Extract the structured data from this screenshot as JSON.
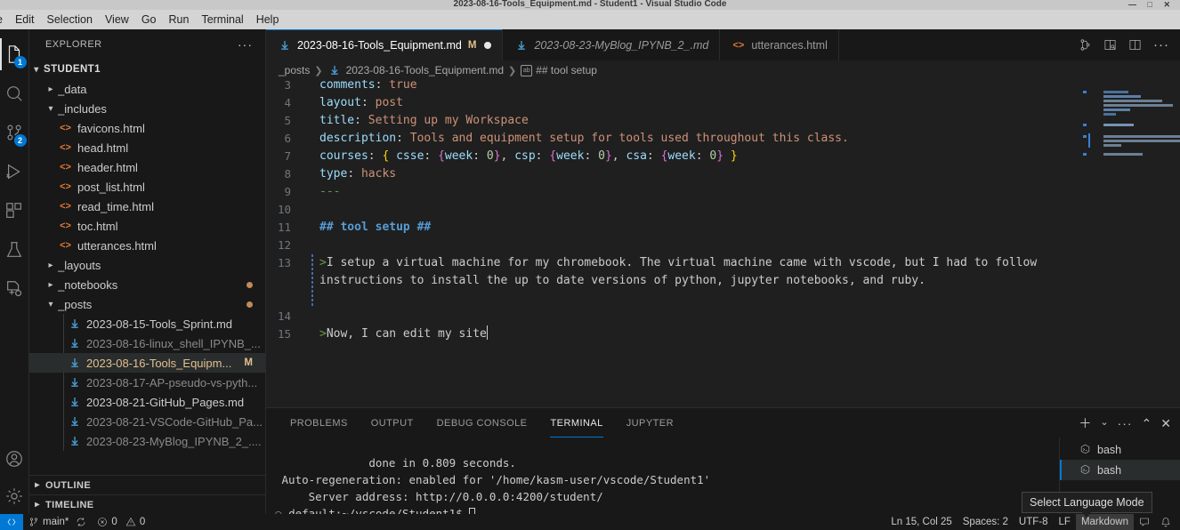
{
  "window": {
    "title": "2023-08-16-Tools_Equipment.md - Student1 - Visual Studio Code",
    "controls": "— □ ✕"
  },
  "menubar": {
    "items": [
      {
        "label": "e"
      },
      {
        "label": "Edit"
      },
      {
        "label": "Selection"
      },
      {
        "label": "View"
      },
      {
        "label": "Go"
      },
      {
        "label": "Run"
      },
      {
        "label": "Terminal"
      },
      {
        "label": "Help"
      }
    ]
  },
  "activitybar": {
    "items": [
      {
        "name": "explorer",
        "icon": "files-icon",
        "badge": "1",
        "selected": true
      },
      {
        "name": "search",
        "icon": "search-icon",
        "badge": "",
        "selected": false
      },
      {
        "name": "source-control",
        "icon": "source-control-icon",
        "badge": "2",
        "selected": false
      },
      {
        "name": "run-debug",
        "icon": "run-debug-icon",
        "badge": "",
        "selected": false
      },
      {
        "name": "extensions",
        "icon": "extensions-icon",
        "badge": "",
        "selected": false
      },
      {
        "name": "testing",
        "icon": "beaker-icon",
        "badge": "",
        "selected": false
      },
      {
        "name": "remote-explorer",
        "icon": "remote-explorer-icon",
        "badge": "",
        "selected": false
      }
    ],
    "bottom": [
      {
        "name": "accounts",
        "icon": "account-icon"
      },
      {
        "name": "manage",
        "icon": "gear-icon"
      }
    ]
  },
  "sidebar": {
    "title": "EXPLORER",
    "more_label": "···",
    "root": {
      "label": "STUDENT1",
      "expanded": true
    },
    "tree": [
      {
        "label": "_data",
        "type": "folder",
        "expanded": false,
        "depth": 1,
        "dirty": false
      },
      {
        "label": "_includes",
        "type": "folder",
        "expanded": true,
        "depth": 1,
        "dirty": false
      },
      {
        "label": "favicons.html",
        "type": "html",
        "depth": 2
      },
      {
        "label": "head.html",
        "type": "html",
        "depth": 2
      },
      {
        "label": "header.html",
        "type": "html",
        "depth": 2
      },
      {
        "label": "post_list.html",
        "type": "html",
        "depth": 2
      },
      {
        "label": "read_time.html",
        "type": "html",
        "depth": 2
      },
      {
        "label": "toc.html",
        "type": "html",
        "depth": 2
      },
      {
        "label": "utterances.html",
        "type": "html",
        "depth": 2
      },
      {
        "label": "_layouts",
        "type": "folder",
        "expanded": false,
        "depth": 1,
        "dirty": false
      },
      {
        "label": "_notebooks",
        "type": "folder",
        "expanded": false,
        "depth": 1,
        "dirty": true
      },
      {
        "label": "_posts",
        "type": "folder",
        "expanded": true,
        "depth": 1,
        "dirty": true
      },
      {
        "label": "2023-08-15-Tools_Sprint.md",
        "type": "md",
        "depth": 2,
        "bright": true
      },
      {
        "label": "2023-08-16-linux_shell_IPYNB_...",
        "type": "md",
        "depth": 2,
        "bright": false
      },
      {
        "label": "2023-08-16-Tools_Equipm...",
        "type": "md",
        "depth": 2,
        "selected": true,
        "flag": "M"
      },
      {
        "label": "2023-08-17-AP-pseudo-vs-pyth...",
        "type": "md",
        "depth": 2,
        "bright": false
      },
      {
        "label": "2023-08-21-GitHub_Pages.md",
        "type": "md",
        "depth": 2,
        "bright": true
      },
      {
        "label": "2023-08-21-VSCode-GitHub_Pa...",
        "type": "md",
        "depth": 2,
        "bright": false
      },
      {
        "label": "2023-08-23-MyBlog_IPYNB_2_....",
        "type": "md",
        "depth": 2,
        "bright": false
      }
    ],
    "sections": [
      {
        "label": "OUTLINE",
        "expanded": false
      },
      {
        "label": "TIMELINE",
        "expanded": false
      }
    ]
  },
  "tabs": [
    {
      "label": "2023-08-16-Tools_Equipment.md",
      "type": "md",
      "active": true,
      "italic": false,
      "modified_flag": "M",
      "dirty": true
    },
    {
      "label": "2023-08-23-MyBlog_IPYNB_2_.md",
      "type": "md",
      "active": false,
      "italic": true,
      "modified_flag": "",
      "dirty": false
    },
    {
      "label": "utterances.html",
      "type": "html",
      "active": false,
      "italic": false,
      "modified_flag": "",
      "dirty": false
    }
  ],
  "editor_actions": [
    {
      "name": "open-preview-icon",
      "label": ""
    },
    {
      "name": "open-preview-to-side-icon",
      "label": ""
    },
    {
      "name": "split-editor-icon",
      "label": ""
    },
    {
      "name": "more-actions-icon",
      "label": "···"
    }
  ],
  "breadcrumb": [
    {
      "label": "_posts",
      "icon": ""
    },
    {
      "label": "2023-08-16-Tools_Equipment.md",
      "icon": "md-icon"
    },
    {
      "label": "## tool setup",
      "icon": "symbol-string-icon"
    }
  ],
  "editor": {
    "lines": [
      {
        "num": "3",
        "fold": false,
        "tokens": [
          {
            "t": "comments",
            "c": "k"
          },
          {
            "t": ": ",
            "c": "p"
          },
          {
            "t": "true",
            "c": "v"
          }
        ]
      },
      {
        "num": "4",
        "fold": false,
        "tokens": [
          {
            "t": "layout",
            "c": "k"
          },
          {
            "t": ": ",
            "c": "p"
          },
          {
            "t": "post",
            "c": "v"
          }
        ]
      },
      {
        "num": "5",
        "fold": true,
        "tokens": [
          {
            "t": "title",
            "c": "k"
          },
          {
            "t": ": ",
            "c": "p"
          },
          {
            "t": "Setting up my Workspace",
            "c": "v"
          }
        ]
      },
      {
        "num": "6",
        "fold": false,
        "tokens": [
          {
            "t": "description",
            "c": "k"
          },
          {
            "t": ": ",
            "c": "p"
          },
          {
            "t": "Tools and equipment setup for tools used throughout this class.",
            "c": "v"
          }
        ]
      },
      {
        "num": "7",
        "fold": false,
        "tokens": [
          {
            "t": "courses",
            "c": "k"
          },
          {
            "t": ": ",
            "c": "p"
          },
          {
            "t": "{",
            "c": "brc"
          },
          {
            "t": " ",
            "c": "p"
          },
          {
            "t": "csse",
            "c": "k"
          },
          {
            "t": ": ",
            "c": "p"
          },
          {
            "t": "{",
            "c": "brc2"
          },
          {
            "t": "week",
            "c": "k"
          },
          {
            "t": ": ",
            "c": "p"
          },
          {
            "t": "0",
            "c": "num"
          },
          {
            "t": "}",
            "c": "brc2"
          },
          {
            "t": ", ",
            "c": "p"
          },
          {
            "t": "csp",
            "c": "k"
          },
          {
            "t": ": ",
            "c": "p"
          },
          {
            "t": "{",
            "c": "brc2"
          },
          {
            "t": "week",
            "c": "k"
          },
          {
            "t": ": ",
            "c": "p"
          },
          {
            "t": "0",
            "c": "num"
          },
          {
            "t": "}",
            "c": "brc2"
          },
          {
            "t": ", ",
            "c": "p"
          },
          {
            "t": "csa",
            "c": "k"
          },
          {
            "t": ": ",
            "c": "p"
          },
          {
            "t": "{",
            "c": "brc2"
          },
          {
            "t": "week",
            "c": "k"
          },
          {
            "t": ": ",
            "c": "p"
          },
          {
            "t": "0",
            "c": "num"
          },
          {
            "t": "}",
            "c": "brc2"
          },
          {
            "t": " ",
            "c": "p"
          },
          {
            "t": "}",
            "c": "brc"
          }
        ]
      },
      {
        "num": "8",
        "fold": false,
        "tokens": [
          {
            "t": "type",
            "c": "k"
          },
          {
            "t": ": ",
            "c": "p"
          },
          {
            "t": "hacks",
            "c": "v"
          }
        ]
      },
      {
        "num": "9",
        "fold": false,
        "tokens": [
          {
            "t": "---",
            "c": "dash"
          }
        ]
      },
      {
        "num": "10",
        "fold": false,
        "tokens": []
      },
      {
        "num": "11",
        "fold": true,
        "tokens": [
          {
            "t": "## tool setup ##",
            "c": "hd"
          }
        ]
      },
      {
        "num": "12",
        "fold": false,
        "tokens": []
      },
      {
        "num": "13",
        "fold": true,
        "tokens": [
          {
            "t": ">",
            "c": "qt"
          },
          {
            "t": "I setup a virtual machine for my chromebook. The virtual machine came with vscode, but I had to follow instructions to install the up to date versions of python, jupyter notebooks, and ruby.",
            "c": "p"
          }
        ]
      },
      {
        "num": "14",
        "fold": false,
        "tokens": []
      },
      {
        "num": "15",
        "fold": true,
        "tokens": [
          {
            "t": ">",
            "c": "qt"
          },
          {
            "t": "Now, I can edit my site",
            "c": "p"
          }
        ],
        "cursor": true
      }
    ]
  },
  "panel": {
    "tabs": [
      {
        "label": "PROBLEMS",
        "active": false
      },
      {
        "label": "OUTPUT",
        "active": false
      },
      {
        "label": "DEBUG CONSOLE",
        "active": false
      },
      {
        "label": "TERMINAL",
        "active": true
      },
      {
        "label": "JUPYTER",
        "active": false
      }
    ],
    "actions": [
      {
        "name": "new-terminal-icon",
        "glyph": "＋"
      },
      {
        "name": "terminal-dropdown-icon",
        "glyph": "⌄"
      },
      {
        "name": "panel-more-icon",
        "glyph": "···"
      },
      {
        "name": "maximize-panel-icon",
        "glyph": "⌃"
      },
      {
        "name": "close-panel-icon",
        "glyph": "✕"
      }
    ],
    "terminal_lines": [
      "              done in 0.809 seconds.",
      " Auto-regeneration: enabled for '/home/kasm-user/vscode/Student1'",
      "     Server address: http://0.0.0.0:4200/student/"
    ],
    "prompt": "default:~/vscode/Student1$ ",
    "prompt_bullet": "○",
    "terminal_list": [
      {
        "label": "bash",
        "selected": false
      },
      {
        "label": "bash",
        "selected": true
      }
    ]
  },
  "tooltip": {
    "text": "Select Language Mode"
  },
  "statusbar": {
    "remote_icon": "remote-host-icon",
    "left": [
      {
        "name": "branch",
        "icon": "source-control-icon",
        "label": "main*"
      },
      {
        "name": "sync",
        "icon": "sync-icon",
        "label": ""
      },
      {
        "name": "errors",
        "icon": "error-icon",
        "label": "0"
      },
      {
        "name": "warnings",
        "icon": "warning-icon",
        "label": "0"
      }
    ],
    "right": [
      {
        "name": "cursor-position",
        "label": "Ln 15, Col 25",
        "highlight": false
      },
      {
        "name": "indentation",
        "label": "Spaces: 2",
        "highlight": false
      },
      {
        "name": "encoding",
        "label": "UTF-8",
        "highlight": false
      },
      {
        "name": "eol",
        "label": "LF",
        "highlight": false
      },
      {
        "name": "language-mode",
        "label": "Markdown",
        "highlight": true
      }
    ],
    "right_icons": [
      {
        "name": "feedback-icon"
      },
      {
        "name": "bell-icon"
      }
    ]
  },
  "colors": {
    "accent": "#0078d4",
    "modified": "#e2c08d",
    "html_icon": "#e37933",
    "md_icon": "#4a9fd8"
  }
}
